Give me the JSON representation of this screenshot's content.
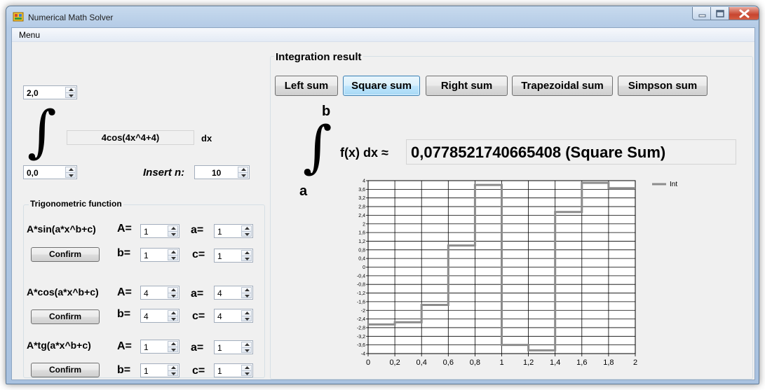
{
  "window": {
    "title": "Numerical Math Solver"
  },
  "menu": {
    "label": "Menu"
  },
  "left_panel": {
    "upper_limit": "2,0",
    "lower_limit": "0,0",
    "function_text": "4cos(4x^4+4)",
    "dx_label": "dx",
    "insert_n_label": "Insert n:",
    "n_value": "10",
    "integral_symbol": "∫"
  },
  "trig": {
    "group_title": "Trigonometric function",
    "sin": {
      "formula": "A*sin(a*x^b+c)",
      "A_label": "A=",
      "A": "1",
      "a_label": "a=",
      "a": "1",
      "b_label": "b=",
      "b": "1",
      "c_label": "c=",
      "c": "1",
      "confirm_label": "Confirm"
    },
    "cos": {
      "formula": "A*cos(a*x^b+c)",
      "A_label": "A=",
      "A": "4",
      "a_label": "a=",
      "a": "4",
      "b_label": "b=",
      "b": "4",
      "c_label": "c=",
      "c": "4",
      "confirm_label": "Confirm"
    },
    "tg": {
      "formula": "A*tg(a*x^b+c)",
      "A_label": "A=",
      "A": "1",
      "a_label": "a=",
      "a": "1",
      "b_label": "b=",
      "b": "1",
      "c_label": "c=",
      "c": "1",
      "confirm_label": "Confirm"
    }
  },
  "right_panel": {
    "group_title": "Integration result",
    "buttons": [
      "Left sum",
      "Square sum",
      "Right sum",
      "Trapezoidal sum",
      "Simpson sum"
    ],
    "active_button": "Square sum",
    "upper_symbol": "b",
    "lower_symbol": "a",
    "integral_symbol": "∫",
    "fx_label": "f(x) dx ≈",
    "result": "0,0778521740665408 (Square Sum)"
  },
  "colors": {
    "series": "#8c8c8c",
    "grid": "#000000",
    "active_button": "#bee6fd",
    "close_button": "#c8452f"
  },
  "icons": [
    "app-icon",
    "minimize-icon",
    "maximize-icon",
    "close-icon",
    "spin-up-icon",
    "spin-down-icon"
  ],
  "chart_data": {
    "type": "line",
    "step": true,
    "x_ticks": [
      "0",
      "0,2",
      "0,4",
      "0,6",
      "0,8",
      "1",
      "1,2",
      "1,4",
      "1,6",
      "1,8",
      "2"
    ],
    "y_ticks": [
      "4",
      "3,6",
      "3,2",
      "2,8",
      "2,4",
      "2",
      "1,6",
      "1,2",
      "0,8",
      "0,4",
      "0",
      "-0,4",
      "-0,8",
      "-1,2",
      "-1,6",
      "-2",
      "-2,4",
      "-2,8",
      "-3,2",
      "-3,6",
      "-4"
    ],
    "xlim": [
      0,
      2
    ],
    "ylim": [
      -4,
      4
    ],
    "grid": true,
    "legend_position": "top-right",
    "series": [
      {
        "name": "Int",
        "x": [
          0,
          0.2,
          0.4,
          0.6,
          0.8,
          1.0,
          1.2,
          1.4,
          1.6,
          1.8,
          2.0
        ],
        "y": [
          -2.65,
          -2.55,
          -1.75,
          1.0,
          3.8,
          -3.6,
          -3.85,
          2.55,
          3.9,
          3.65,
          3.65
        ]
      }
    ]
  }
}
